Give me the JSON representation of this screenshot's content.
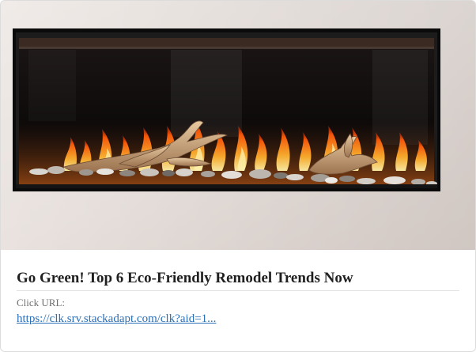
{
  "ad": {
    "image_alt": "Linear electric fireplace with driftwood and stones",
    "headline": "Go Green! Top 6 Eco-Friendly Remodel Trends Now",
    "click_url_label": "Click URL:",
    "click_url": "https://clk.srv.stackadapt.com/clk?aid=1..."
  },
  "colors": {
    "wall": "#e9e2de",
    "frame": "#111111",
    "flame": "#ff7a1a",
    "link": "#2a6fb7",
    "headline": "#1f1f1f",
    "muted": "#6f6f6f"
  }
}
